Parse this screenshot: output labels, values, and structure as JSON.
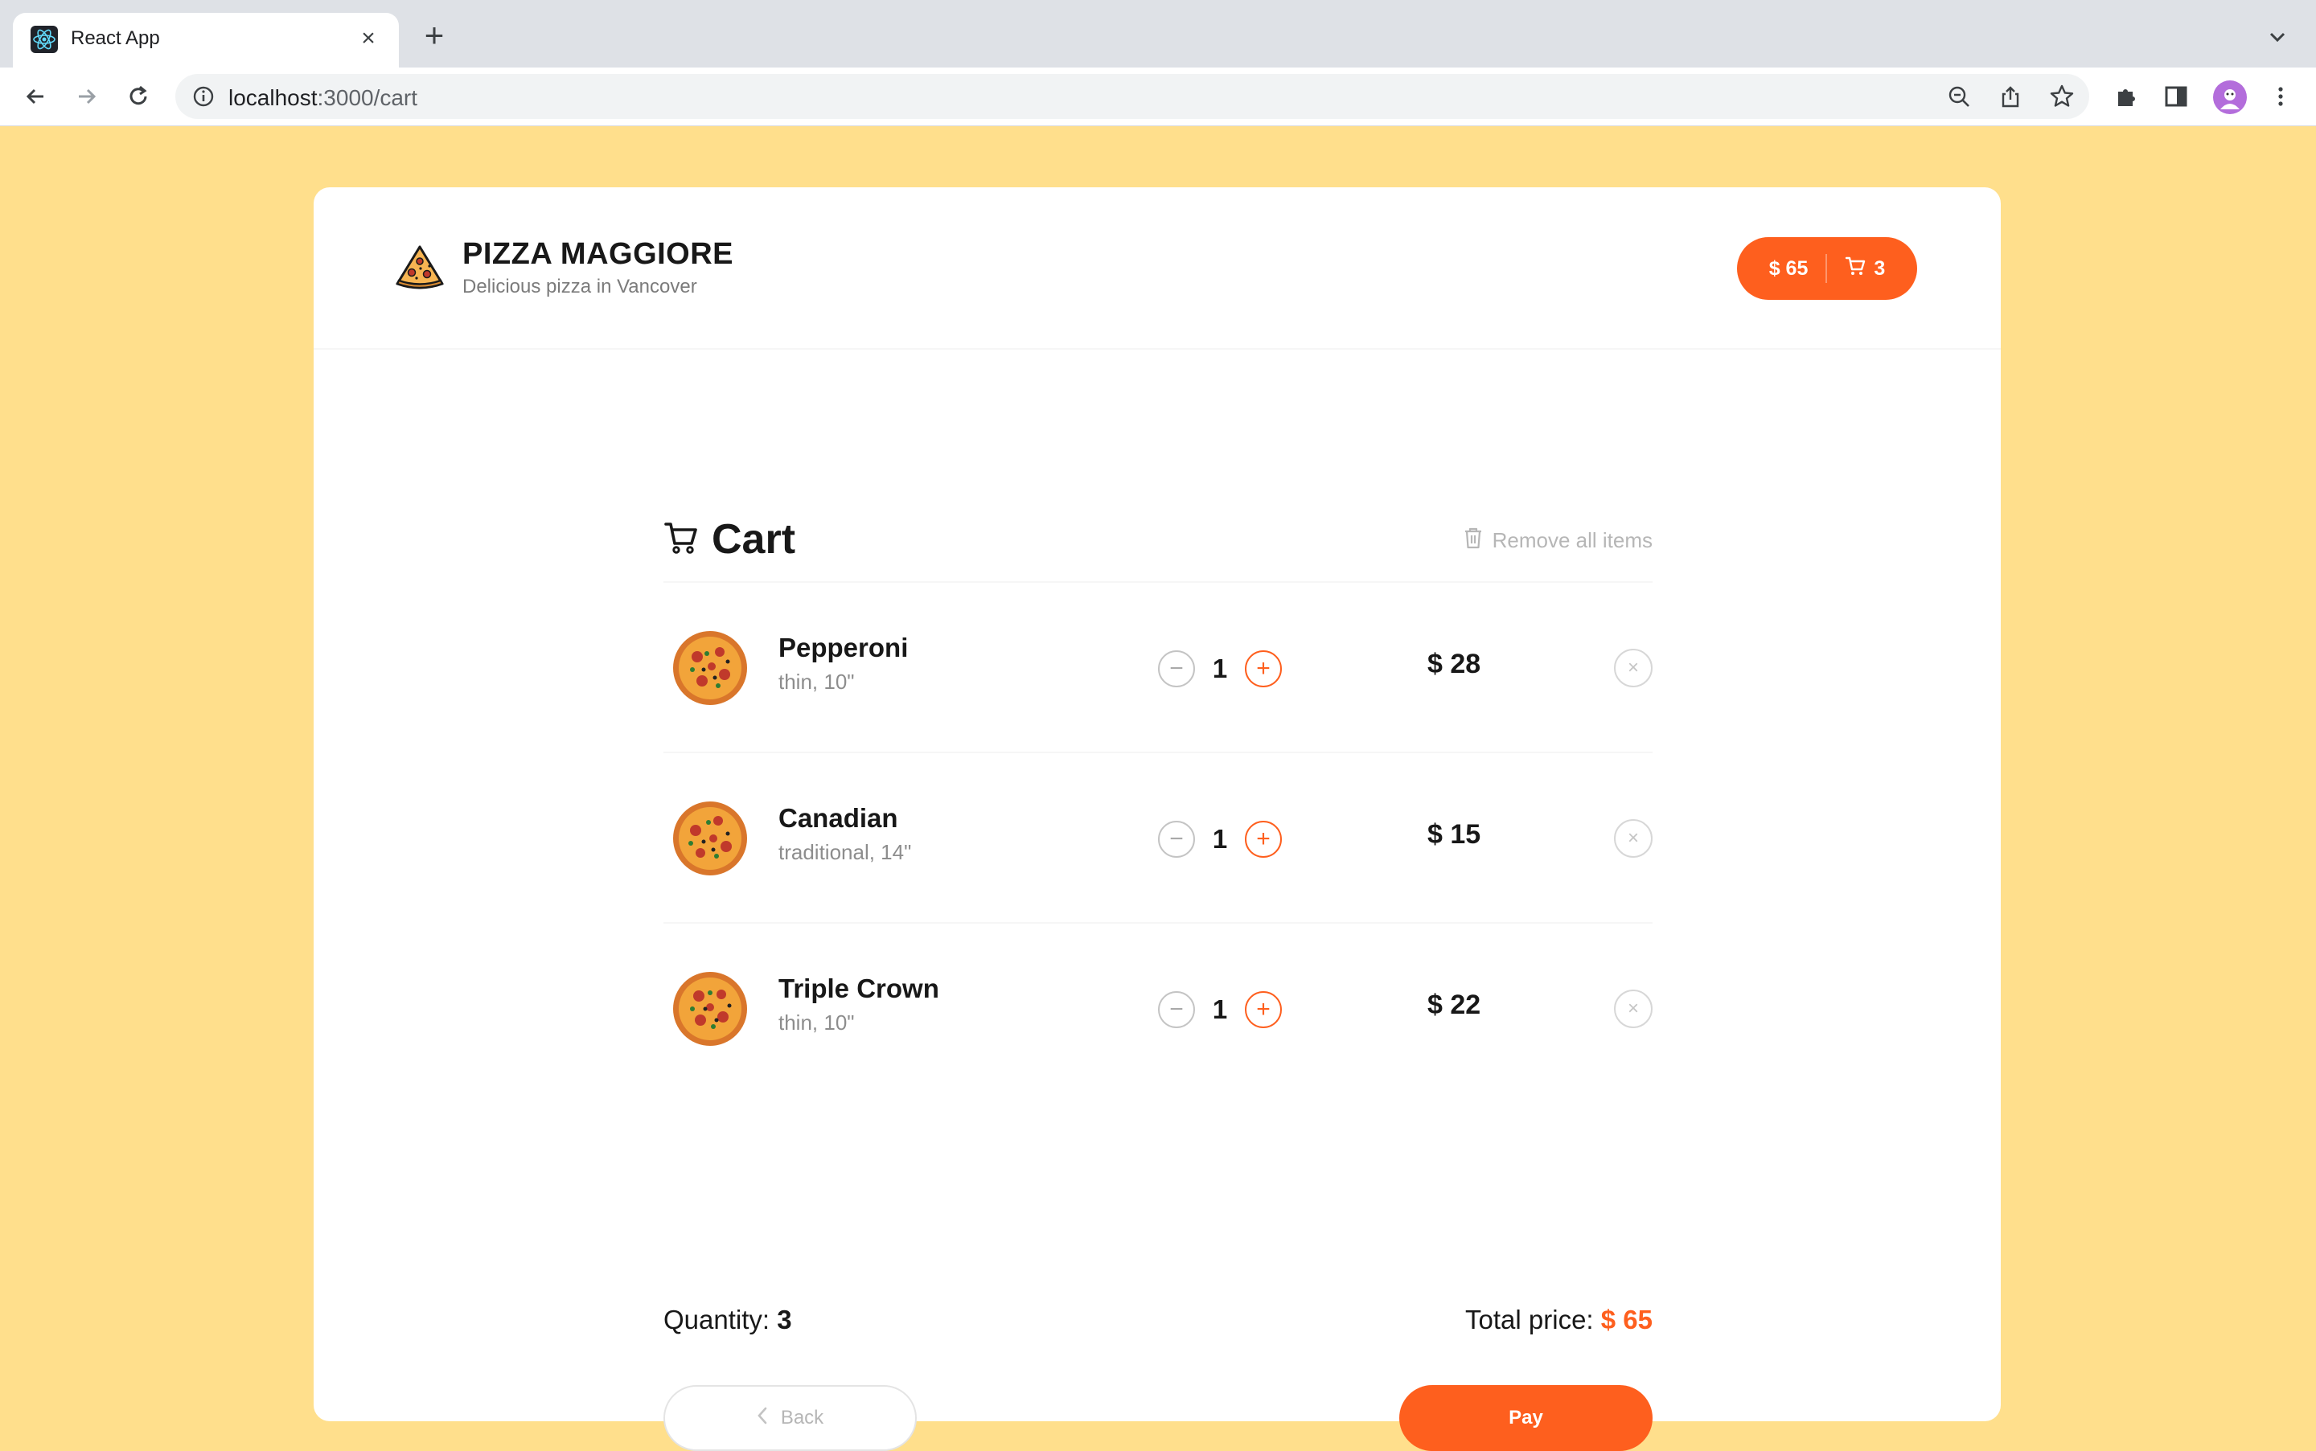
{
  "browser": {
    "tab_title": "React App",
    "url_host": "localhost",
    "url_path": ":3000/cart"
  },
  "header": {
    "brand": "PIZZA MAGGIORE",
    "tagline": "Delicious pizza in Vancover",
    "cart_total": "$ 65",
    "cart_count": "3"
  },
  "cart": {
    "title": "Cart",
    "remove_all": "Remove all items",
    "items": [
      {
        "name": "Pepperoni",
        "desc": "thin, 10\"",
        "qty": "1",
        "price": "$ 28"
      },
      {
        "name": "Canadian",
        "desc": "traditional, 14\"",
        "qty": "1",
        "price": "$ 15"
      },
      {
        "name": "Triple Crown",
        "desc": "thin, 10\"",
        "qty": "1",
        "price": "$ 22"
      }
    ],
    "quantity_label": "Quantity:",
    "quantity_value": "3",
    "total_label": "Total price:",
    "total_value": "$ 65",
    "back_label": "Back",
    "pay_label": "Pay"
  },
  "colors": {
    "page_background": "#ffdf8c",
    "accent": "#fe5f1e"
  }
}
